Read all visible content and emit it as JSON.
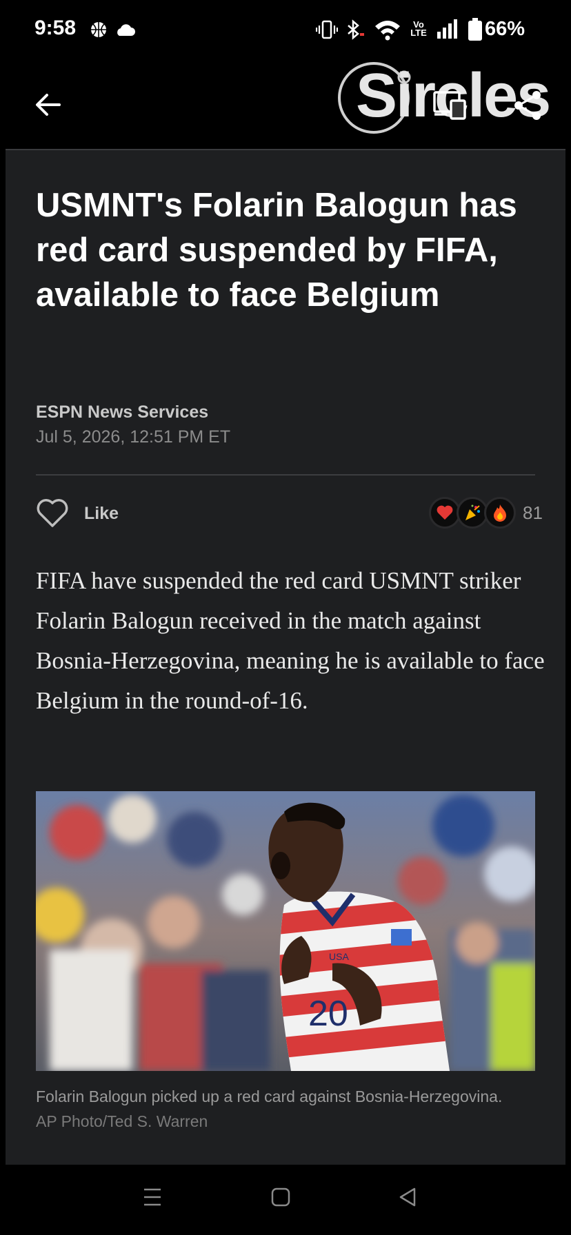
{
  "status_bar": {
    "time": "9:58",
    "battery": "66%",
    "icons": [
      "basketball-icon",
      "cloud-icon",
      "vibrate-icon",
      "bluetooth-icon",
      "wifi-icon",
      "volte-icon",
      "signal-icon",
      "battery-icon"
    ],
    "volte_label": "Vo LTE"
  },
  "app_bar": {
    "logo_text": "Sircles",
    "icons": [
      "back-arrow-icon",
      "cast-icon",
      "share-icon"
    ]
  },
  "article": {
    "headline": "USMNT's Folarin Balogun has red card suspended by FIFA, available to face Belgium",
    "source": "ESPN News Services",
    "date": "Jul 5, 2026, 12:51 PM ET",
    "like_label": "Like",
    "reaction_count": "81",
    "reactions": [
      "heart-reaction-icon",
      "party-reaction-icon",
      "fire-reaction-icon"
    ],
    "body": "FIFA have suspended the red card USMNT striker Folarin Balogun received in the match against Bosnia-Herzegovina, meaning he is available to face Belgium in the round-of-16.",
    "photo": {
      "jersey_text": "USA",
      "jersey_number": "20"
    },
    "caption": "Folarin Balogun picked up a red card against Bosnia-Herzegovina.",
    "credit": "AP Photo/Ted S. Warren"
  },
  "nav_bar": {
    "icons": [
      "recents-icon",
      "home-icon",
      "back-icon"
    ]
  },
  "colors": {
    "background": "#000000",
    "card": "#1e1f21",
    "text_primary": "#ffffff",
    "text_secondary": "#9a9a9a"
  }
}
